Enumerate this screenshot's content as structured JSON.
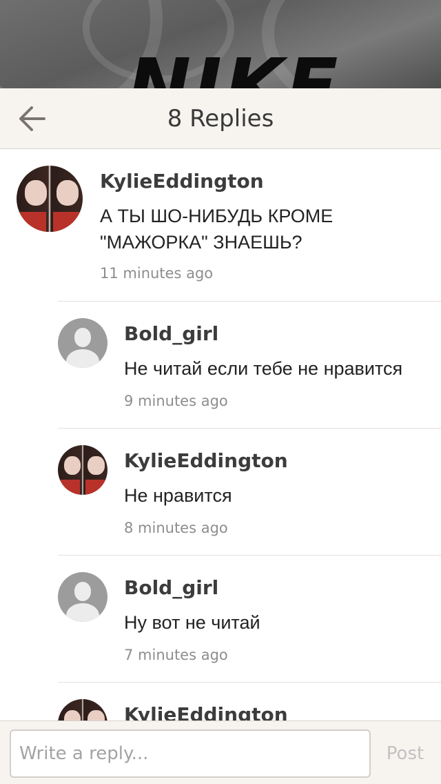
{
  "background": {
    "brand_text": "NIKE"
  },
  "header": {
    "title": "8 Replies",
    "back_icon": "arrow-left-icon"
  },
  "comments": [
    {
      "username": "KylieEddington",
      "text": "А ТЫ ШО-НИБУДЬ КРОМЕ \"МАЖОРКА\" ЗНАЕШЬ?",
      "time": "11 minutes ago",
      "avatar": "photo"
    },
    {
      "username": "Bold_girl",
      "text": "Не читай если тебе не нравится",
      "time": "9 minutes ago",
      "avatar": "default"
    },
    {
      "username": "KylieEddington",
      "text": "Не нравится",
      "time": "8 minutes ago",
      "avatar": "photo"
    },
    {
      "username": "Bold_girl",
      "text": "Ну вот не читай",
      "time": "7 minutes ago",
      "avatar": "default"
    },
    {
      "username": "KylieEddington",
      "text": "",
      "time": "",
      "avatar": "photo"
    }
  ],
  "reply_bar": {
    "placeholder": "Write a reply...",
    "post_label": "Post"
  },
  "colors": {
    "header_bg": "#f7f4f0",
    "text_dark": "#3c3c3c",
    "timestamp": "#8d8d8d",
    "post_disabled": "#c2c2c2"
  }
}
